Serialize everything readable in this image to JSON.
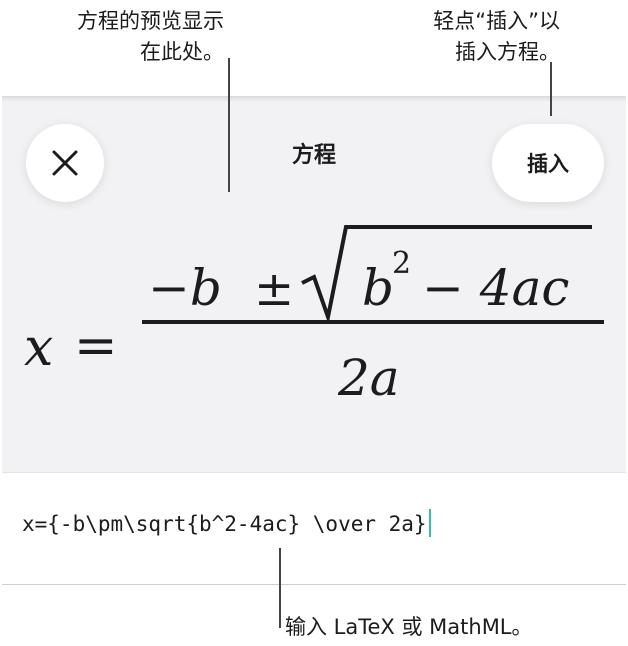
{
  "callouts": {
    "preview_line1": "方程的预览显示",
    "preview_line2": "在此处。",
    "insert_line1": "轻点“插入”以",
    "insert_line2": "插入方程。",
    "input_hint": "输入 LaTeX 或 MathML。"
  },
  "header": {
    "title": "方程",
    "close_icon": "close-x-icon",
    "insert_label": "插入"
  },
  "preview": {
    "lhs": "x",
    "equals": "=",
    "num_minus_b": "−b",
    "pm": "±",
    "b": "b",
    "exp": "2",
    "minus_4ac": "− 4ac",
    "denominator": "2a"
  },
  "editor": {
    "value": "x={-b\\pm\\sqrt{b^2-4ac} \\over 2a}",
    "caret_color": "#34c0a8"
  }
}
